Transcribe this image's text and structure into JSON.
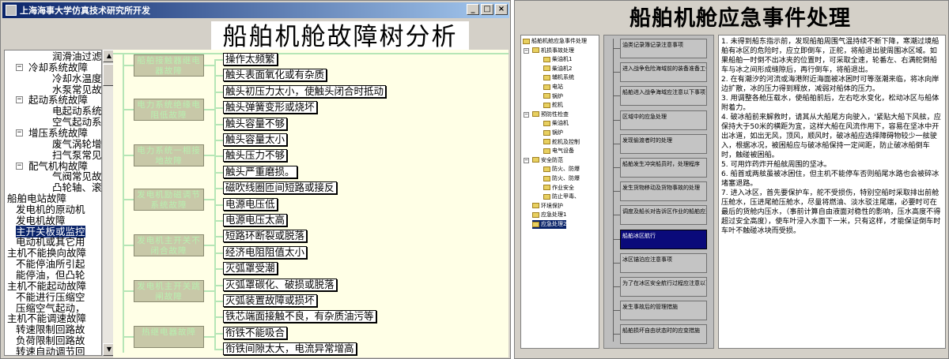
{
  "left_window": {
    "title": "上海海事大学仿真技术研究所开发",
    "heading": "船舶机舱故障树分析",
    "controls": {
      "minimize": "_",
      "maximize": "□",
      "close": "×"
    },
    "tree_items": [
      {
        "label": "润滑油过滤",
        "level": 3
      },
      {
        "label": "冷却系统故障",
        "level": 2
      },
      {
        "label": "冷却水温度",
        "level": 3
      },
      {
        "label": "水泵常见故",
        "level": 3
      },
      {
        "label": "起动系统故障",
        "level": 2
      },
      {
        "label": "电起动系统",
        "level": 3
      },
      {
        "label": "空气起动系",
        "level": 3
      },
      {
        "label": "增压系统故障",
        "level": 2
      },
      {
        "label": "废气涡轮增",
        "level": 3
      },
      {
        "label": "扫气泵常见",
        "level": 3
      },
      {
        "label": "配气机构故障",
        "level": 2
      },
      {
        "label": "气阀常见故",
        "level": 3
      },
      {
        "label": "凸轮轴、滚",
        "level": 3
      },
      {
        "label": "船舶电站故障",
        "level": 0
      },
      {
        "label": "发电机的原动机",
        "level": 1
      },
      {
        "label": "发电机故障",
        "level": 1
      },
      {
        "label": "主开关板或监控",
        "level": 1,
        "selected": true
      },
      {
        "label": "电动机或其它用",
        "level": 1
      },
      {
        "label": "主机不能换向故障",
        "level": 0
      },
      {
        "label": "不能停油所引起",
        "level": 1
      },
      {
        "label": "能停油，但凸轮",
        "level": 1
      },
      {
        "label": "主机不能起动故障",
        "level": 0
      },
      {
        "label": "不能进行压缩空",
        "level": 1
      },
      {
        "label": "压缩空气起动，",
        "level": 1
      },
      {
        "label": "主机不能调速故障",
        "level": 0
      },
      {
        "label": "转速限制回路故",
        "level": 1
      },
      {
        "label": "负荷限制回路故",
        "level": 1
      },
      {
        "label": "转速自动调节回",
        "level": 1
      }
    ],
    "fault_groups": [
      {
        "label": "船舶接触器继电器故障"
      },
      {
        "label": "电力系统绝缘电阻低故障"
      },
      {
        "label": "电力系统一相接地故障"
      },
      {
        "label": "发电机励磁调节系统故障"
      },
      {
        "label": "发电机主开关不闭合故障"
      },
      {
        "label": "发电机主开关跳闸故障"
      },
      {
        "label": "热继电器故障"
      }
    ],
    "faults": [
      "操作太频繁",
      "触头表面氧化或有杂质",
      "触头初压力太小，使触头闭合时抵动",
      "触头弹簧变形或烧坏",
      "触头容量不够",
      "触头容量太小",
      "触头压力不够",
      "触头严重磨损。",
      "磁吹线圈匝间短路或接反",
      "电源电压低",
      "电源电压太高",
      "短路环断裂或脱落",
      "经济电阻阻值太小",
      "灭弧罩受潮",
      "灭弧罩碳化、破损或脱落",
      "灭弧装置故障或损坏",
      "铁芯端面接触不良，有杂质油污等",
      "衔铁不能吸合",
      "衔铁间隙太大，电流异常增高"
    ]
  },
  "right_window": {
    "heading": "船舶机舱应急事件处理",
    "tree_items": [
      {
        "label": "船舶机舱应急事件处理",
        "level": 0
      },
      {
        "label": "机损事故处理",
        "level": 1
      },
      {
        "label": "柴油机1",
        "level": 2
      },
      {
        "label": "柴油机2",
        "level": 2
      },
      {
        "label": "辅机系统",
        "level": 2
      },
      {
        "label": "电站",
        "level": 2
      },
      {
        "label": "锅炉",
        "level": 2
      },
      {
        "label": "舵机",
        "level": 2
      },
      {
        "label": "预防性检查",
        "level": 1
      },
      {
        "label": "柴油机",
        "level": 2
      },
      {
        "label": "锅炉",
        "level": 2
      },
      {
        "label": "舵机及控制",
        "level": 2
      },
      {
        "label": "电气设备",
        "level": 2
      },
      {
        "label": "安全防范",
        "level": 1
      },
      {
        "label": "防火、防爆",
        "level": 2
      },
      {
        "label": "防火、防爆",
        "level": 2
      },
      {
        "label": "作业安全",
        "level": 2
      },
      {
        "label": "防止甲毒、",
        "level": 2
      },
      {
        "label": "环境保护",
        "level": 1
      },
      {
        "label": "应急处理1",
        "level": 1
      },
      {
        "label": "应急处理2",
        "level": 1,
        "selected": true
      }
    ],
    "procedures": [
      {
        "label": "油类记录簿记录注意事项"
      },
      {
        "label": "进入战争危险海域前的装备准备工作"
      },
      {
        "label": "船舶进入战争海域应注意以下事项"
      },
      {
        "label": "区域中的应急处理"
      },
      {
        "label": "发现偷渡者时的处理"
      },
      {
        "label": "船舶发生冲突船员时，处理程序"
      },
      {
        "label": "发生货物移动及货物事故的处理"
      },
      {
        "label": "调度及船长对告诉区作业的船舶应遵守下列要求"
      },
      {
        "label": "船舶冰区航行",
        "selected": true
      },
      {
        "label": "冰区锚泊应注意事项"
      },
      {
        "label": "为了在冰区安全航行过程应注意以下事项"
      },
      {
        "label": "发生事故后的管理措施"
      },
      {
        "label": "船舶损坏自由状态时的应变措施"
      }
    ],
    "content": [
      "1. 未得到船东指示前，发现船舶周围气温持续不断下降，寒潮过境船舶有冰区的危险时，应立即倒车，正舵，将船退出驶周围冰区域。如果船舶一时倒不出冰夹的位置时，可采取全速，轮番左、右满舵倒船车与冰之间形成缝隙后，再行倒车，将船退出。",
      "2. 在有潮汐的河流或海港附近海面被冰困时可等涨潮来临，将冰向岸边扩散，冰的压力得到释放，减弱对船体的压力。",
      "3. 用调整各舱压载水，使船舶前后，左右吃水变化，松动冰区与船体附着力。",
      "4. 破冰船前来解救时，请其从大船尾方向驶入，'紧贴大船下风舷，应保持大于50米的横距为宜，这样大船在风流作用下，容易在坚冰中开出冰道，如出无风，顶风，顺风时，破冰船应选择障碍物较少一舷驶入，根据冰况，被困船应与破冰船保持一定间距，防止破冰船倒车时，触碰被困船。",
      "5. 可用炸药炸开船舷周围的坚冰。",
      "6. 船首或两舷虽被冰困住，但主机不能停车否则船尾水路也会被碎冰堵塞退路。",
      "7. 进入冰区，首先要保护车，舵不受损伤，特别空船时采取排出前舱压舱水，压进尾舱压舱水，尽量将燃油、淡水驳注尾端，必要时可在最后的货舱内压水，（事前计算自由液面对稳性的影响，压水高度不得超过安全高度），使车叶浸入水面下一米，只有这样，才能保证倒车时车叶不触碰冰块而受损。"
    ]
  }
}
